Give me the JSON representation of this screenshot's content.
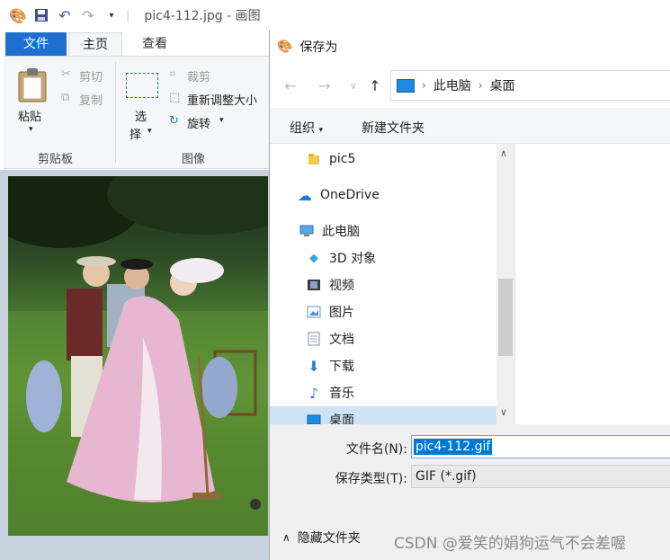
{
  "paint": {
    "title": "pic4-112.jpg - 画图",
    "tabs": {
      "file": "文件",
      "home": "主页",
      "view": "查看"
    },
    "clipboard": {
      "paste": "粘贴",
      "cut": "剪切",
      "copy": "复制",
      "group": "剪贴板"
    },
    "image": {
      "select_1": "选",
      "select_2": "择",
      "crop": "裁剪",
      "resize": "重新调整大小",
      "rotate": "旋转",
      "group": "图像"
    }
  },
  "dialog": {
    "title": "保存为",
    "path": [
      "此电脑",
      "桌面"
    ],
    "toolbar": {
      "organize": "组织",
      "new_folder": "新建文件夹"
    },
    "tree": [
      {
        "label": "pic5",
        "icon": "folder-icon"
      },
      {
        "label": "OneDrive",
        "icon": "cloud-icon"
      },
      {
        "label": "此电脑",
        "icon": "computer-icon"
      },
      {
        "label": "3D 对象",
        "icon": "cube-icon"
      },
      {
        "label": "视频",
        "icon": "video-icon"
      },
      {
        "label": "图片",
        "icon": "picture-icon"
      },
      {
        "label": "文档",
        "icon": "document-icon"
      },
      {
        "label": "下载",
        "icon": "download-icon"
      },
      {
        "label": "音乐",
        "icon": "music-icon"
      },
      {
        "label": "桌面",
        "icon": "desktop-icon"
      }
    ],
    "filename_label": "文件名(N):",
    "filename_value": "pic4-112.gif",
    "filetype_label": "保存类型(T):",
    "filetype_value": "GIF (*.gif)",
    "hide_folders": "隐藏文件夹"
  },
  "watermark": "CSDN @爱笑的娟狗运气不会差喔",
  "colors": {
    "accent": "#0078d7",
    "file_tab": "#1f6fd1"
  }
}
